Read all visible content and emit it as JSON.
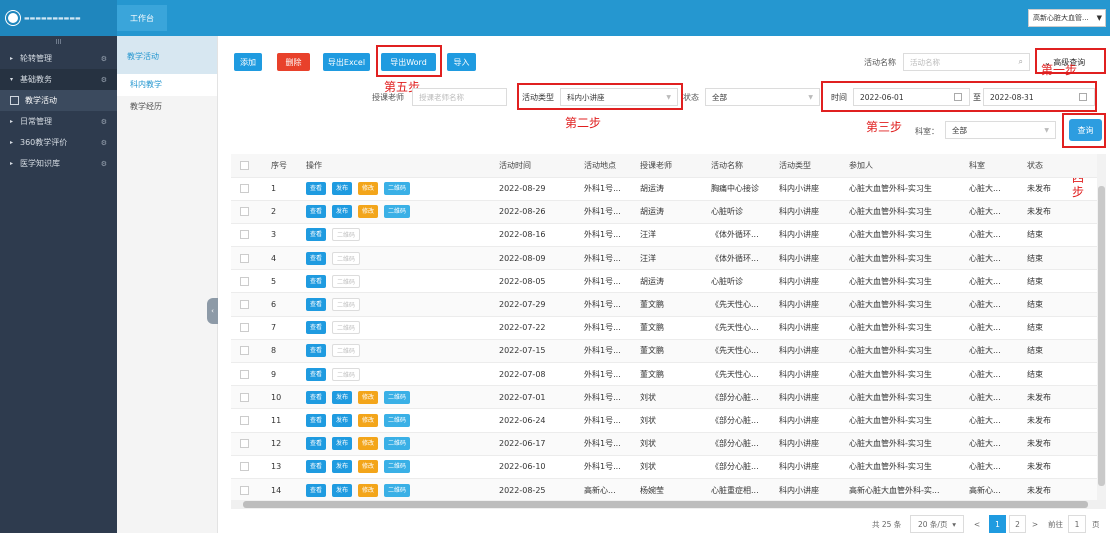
{
  "header": {
    "nav_tab": "工作台",
    "user": "高新心脏大血管..."
  },
  "sidebar": {
    "toggle": "III",
    "items": [
      {
        "label": "轮转管理",
        "arrow": "▸"
      },
      {
        "label": "基础教务",
        "arrow": "▾"
      },
      {
        "label": "教学活动"
      },
      {
        "label": "日常管理",
        "arrow": "▸"
      },
      {
        "label": "360教学评价",
        "arrow": "▸"
      },
      {
        "label": "医学知识库",
        "arrow": "▸"
      }
    ]
  },
  "subnav": {
    "header": "教学活动",
    "items": [
      "科内教学",
      "教学经历"
    ]
  },
  "toolbar": {
    "add": "添加",
    "delete": "删除",
    "export_excel": "导出Excel",
    "export_word": "导出Word",
    "import": "导入",
    "activity_name_label": "活动名称",
    "activity_name_placeholder": "活动名称",
    "advanced": "高级查询"
  },
  "filters": {
    "teacher_label": "授课老师",
    "teacher_placeholder": "授课老师名称",
    "type_label": "活动类型",
    "type_value": "科内小讲座",
    "status_label": "状态",
    "status_value": "全部",
    "time_label": "时间",
    "date_from": "2022-06-01",
    "to": "至",
    "date_to": "2022-08-31",
    "dept_label": "科室：",
    "dept_value": "全部",
    "query": "查询"
  },
  "annotations": {
    "step1": "第一步",
    "step2": "第二步",
    "step3": "第三步",
    "step4": "第四步",
    "step5": "第五步"
  },
  "table": {
    "headers": [
      "序号",
      "操作",
      "活动时间",
      "活动地点",
      "授课老师",
      "活动名称",
      "活动类型",
      "参加人",
      "科室",
      "状态"
    ],
    "btn_view": "查看",
    "btn_pub": "发布",
    "btn_edit": "修改",
    "btn_qr": "二维码",
    "rows": [
      {
        "no": "1",
        "pub": true,
        "time": "2022-08-29",
        "place": "外科1号...",
        "teacher": "胡运涛",
        "name": "胸痛中心接诊",
        "type": "科内小讲座",
        "people": "心脏大血管外科-实习生",
        "dept": "心脏大...",
        "status": "未发布"
      },
      {
        "no": "2",
        "pub": true,
        "time": "2022-08-26",
        "place": "外科1号...",
        "teacher": "胡运涛",
        "name": "心脏听诊",
        "type": "科内小讲座",
        "people": "心脏大血管外科-实习生",
        "dept": "心脏大...",
        "status": "未发布"
      },
      {
        "no": "3",
        "pub": false,
        "time": "2022-08-16",
        "place": "外科1号...",
        "teacher": "汪洋",
        "name": "《体外循环...",
        "type": "科内小讲座",
        "people": "心脏大血管外科-实习生",
        "dept": "心脏大...",
        "status": "结束"
      },
      {
        "no": "4",
        "pub": false,
        "time": "2022-08-09",
        "place": "外科1号...",
        "teacher": "汪洋",
        "name": "《体外循环...",
        "type": "科内小讲座",
        "people": "心脏大血管外科-实习生",
        "dept": "心脏大...",
        "status": "结束"
      },
      {
        "no": "5",
        "pub": false,
        "time": "2022-08-05",
        "place": "外科1号...",
        "teacher": "胡运涛",
        "name": "心脏听诊",
        "type": "科内小讲座",
        "people": "心脏大血管外科-实习生",
        "dept": "心脏大...",
        "status": "结束"
      },
      {
        "no": "6",
        "pub": false,
        "time": "2022-07-29",
        "place": "外科1号...",
        "teacher": "董文鹏",
        "name": "《先天性心...",
        "type": "科内小讲座",
        "people": "心脏大血管外科-实习生",
        "dept": "心脏大...",
        "status": "结束"
      },
      {
        "no": "7",
        "pub": false,
        "time": "2022-07-22",
        "place": "外科1号...",
        "teacher": "董文鹏",
        "name": "《先天性心...",
        "type": "科内小讲座",
        "people": "心脏大血管外科-实习生",
        "dept": "心脏大...",
        "status": "结束"
      },
      {
        "no": "8",
        "pub": false,
        "time": "2022-07-15",
        "place": "外科1号...",
        "teacher": "董文鹏",
        "name": "《先天性心...",
        "type": "科内小讲座",
        "people": "心脏大血管外科-实习生",
        "dept": "心脏大...",
        "status": "结束"
      },
      {
        "no": "9",
        "pub": false,
        "time": "2022-07-08",
        "place": "外科1号...",
        "teacher": "董文鹏",
        "name": "《先天性心...",
        "type": "科内小讲座",
        "people": "心脏大血管外科-实习生",
        "dept": "心脏大...",
        "status": "结束"
      },
      {
        "no": "10",
        "pub": true,
        "time": "2022-07-01",
        "place": "外科1号...",
        "teacher": "刘状",
        "name": "《部分心脏...",
        "type": "科内小讲座",
        "people": "心脏大血管外科-实习生",
        "dept": "心脏大...",
        "status": "未发布"
      },
      {
        "no": "11",
        "pub": true,
        "time": "2022-06-24",
        "place": "外科1号...",
        "teacher": "刘状",
        "name": "《部分心脏...",
        "type": "科内小讲座",
        "people": "心脏大血管外科-实习生",
        "dept": "心脏大...",
        "status": "未发布"
      },
      {
        "no": "12",
        "pub": true,
        "time": "2022-06-17",
        "place": "外科1号...",
        "teacher": "刘状",
        "name": "《部分心脏...",
        "type": "科内小讲座",
        "people": "心脏大血管外科-实习生",
        "dept": "心脏大...",
        "status": "未发布"
      },
      {
        "no": "13",
        "pub": true,
        "time": "2022-06-10",
        "place": "外科1号...",
        "teacher": "刘状",
        "name": "《部分心脏...",
        "type": "科内小讲座",
        "people": "心脏大血管外科-实习生",
        "dept": "心脏大...",
        "status": "未发布"
      },
      {
        "no": "14",
        "pub": true,
        "time": "2022-08-25",
        "place": "高新心...",
        "teacher": "杨婉莹",
        "name": "心脏重症相...",
        "type": "科内小讲座",
        "people": "高新心脏大血管外科-实...",
        "dept": "高新心...",
        "status": "未发布"
      }
    ]
  },
  "pagination": {
    "total": "共 25 条",
    "page_size": "20 条/页",
    "prev": "<",
    "page1": "1",
    "page2": "2",
    "next": ">",
    "goto_label": "前往",
    "goto_value": "1",
    "goto_unit": "页"
  }
}
